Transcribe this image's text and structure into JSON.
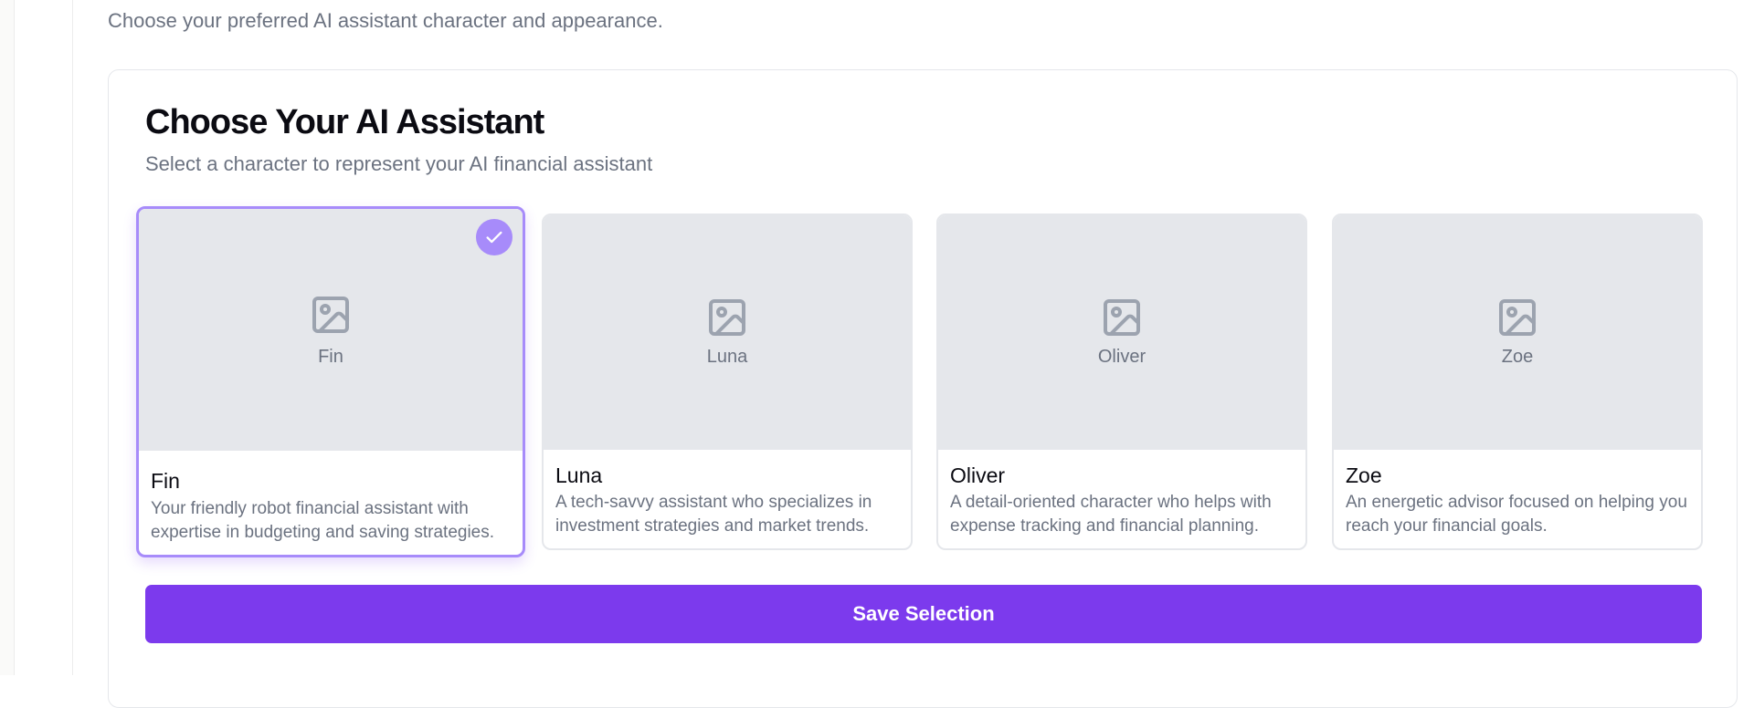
{
  "page": {
    "intro_text": "Choose your preferred AI assistant character and appearance."
  },
  "panel": {
    "title": "Choose Your AI Assistant",
    "subtitle": "Select a character to represent your AI financial assistant"
  },
  "characters": [
    {
      "name": "Fin",
      "image_label": "Fin",
      "description": "Your friendly robot financial assistant with expertise in budgeting and saving strategies.",
      "selected": true,
      "icon": "image-placeholder-icon"
    },
    {
      "name": "Luna",
      "image_label": "Luna",
      "description": "A tech-savvy assistant who specializes in investment strategies and market trends.",
      "selected": false,
      "icon": "image-placeholder-icon"
    },
    {
      "name": "Oliver",
      "image_label": "Oliver",
      "description": "A detail-oriented character who helps with expense tracking and financial planning.",
      "selected": false,
      "icon": "image-placeholder-icon"
    },
    {
      "name": "Zoe",
      "image_label": "Zoe",
      "description": "An energetic advisor focused on helping you reach your financial goals.",
      "selected": false,
      "icon": "image-placeholder-icon"
    }
  ],
  "actions": {
    "save_label": "Save Selection"
  },
  "colors": {
    "accent": "#7c3aed",
    "selected_border": "#a78bfa",
    "thumb_bg": "#e5e7eb",
    "muted_text": "#6b7280"
  }
}
